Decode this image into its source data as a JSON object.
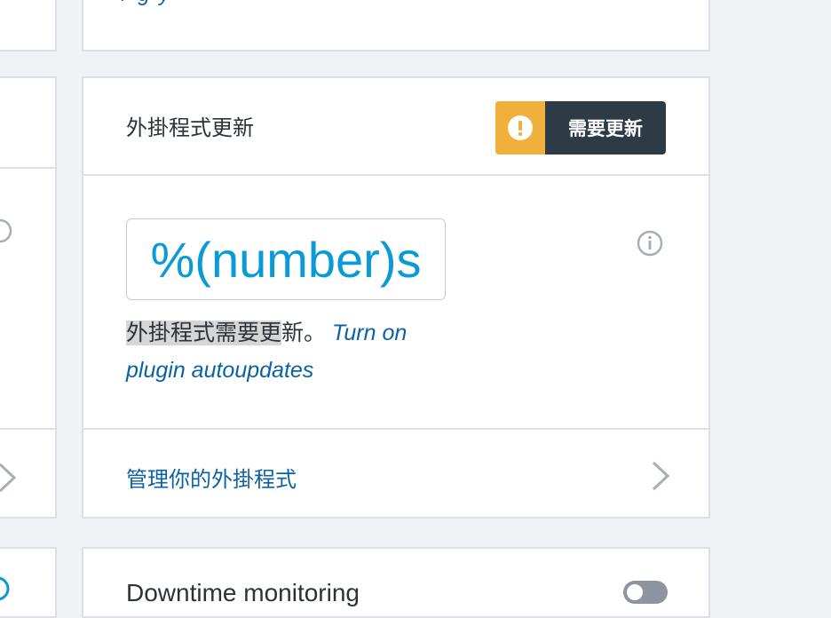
{
  "plugin_updates_card": {
    "title": "外掛程式更新",
    "badge_label": "需要更新",
    "badge_icon": "alert-icon",
    "count_placeholder": "%(number)s",
    "description_highlighted": "外掛程式需要更",
    "description_rest": "新。",
    "autoupdate_link": "Turn on plugin autoupdates",
    "manage_link": "管理你的外掛程式"
  },
  "downtime_card": {
    "label": "Downtime monitoring"
  },
  "colors": {
    "accent_link": "#0b62a3",
    "number": "#0a9bd6",
    "badge_warning": "#f0b03c",
    "badge_dark": "#2d3b47"
  }
}
